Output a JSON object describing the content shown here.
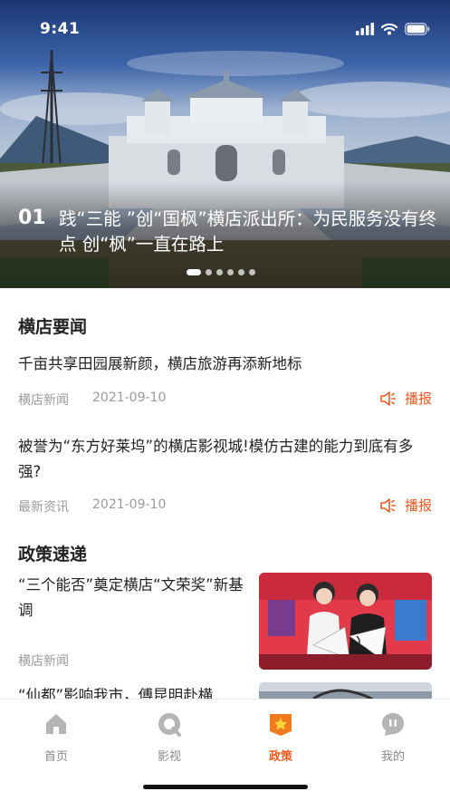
{
  "status_bar": {
    "time": "9:41"
  },
  "hero": {
    "index": "01",
    "title": "践“三能 ”创“国枫”横店派出所：为民服务没有终点 创“枫”一直在路上",
    "slide_count": 6,
    "active_slide": 0
  },
  "news_section": {
    "title": "横店要闻",
    "items": [
      {
        "title": "千亩共享田园展新颜，横店旅游再添新地标",
        "source": "横店新闻",
        "date": "2021-09-10",
        "action": "播报"
      },
      {
        "title": "被誉为“东方好莱坞”的横店影视城!模仿古建的能力到底有多强?",
        "source": "最新资讯",
        "date": "2021-09-10",
        "action": "播报"
      }
    ]
  },
  "policy_section": {
    "title": "政策速递",
    "items": [
      {
        "title": "“三个能否”奠定横店“文荣奖”新基调",
        "source": "横店新闻"
      },
      {
        "title": "“仙都”影响我市，傅昆明赴横"
      }
    ]
  },
  "tabbar": {
    "tabs": [
      {
        "label": "首页",
        "icon": "home-icon",
        "active": false
      },
      {
        "label": "影视",
        "icon": "video-icon",
        "active": false
      },
      {
        "label": "政策",
        "icon": "policy-star-icon",
        "active": true
      },
      {
        "label": "我的",
        "icon": "profile-icon",
        "active": false
      }
    ]
  },
  "colors": {
    "accent": "#f05a22",
    "text": "#222222",
    "muted": "#9a9a9a"
  }
}
